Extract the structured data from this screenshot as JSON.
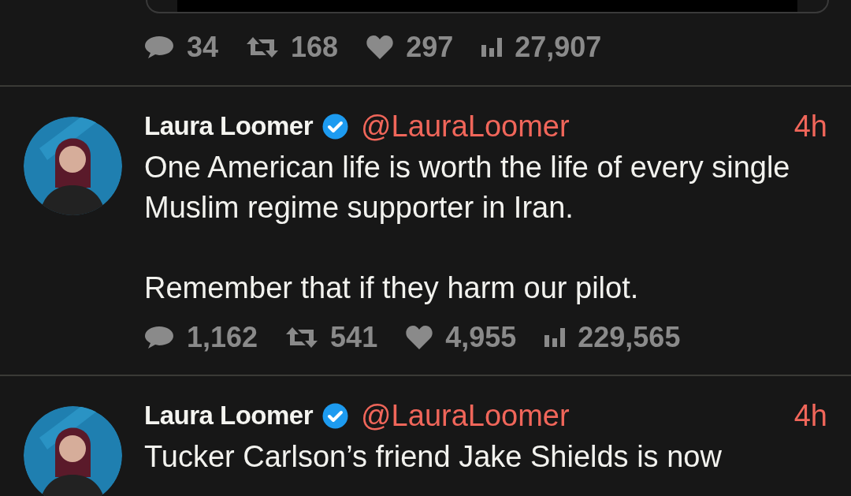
{
  "previous_post": {
    "has_media": true,
    "stats": {
      "replies": "34",
      "reposts": "168",
      "likes": "297",
      "views": "27,907"
    }
  },
  "posts": [
    {
      "author": "Laura Loomer",
      "verified": true,
      "handle": "@LauraLoomer",
      "time": "4h",
      "paragraphs": [
        "One American life is worth the life of every single Muslim regime supporter in Iran.",
        "Remember that if they harm our pilot."
      ],
      "stats": {
        "replies": "1,162",
        "reposts": "541",
        "likes": "4,955",
        "views": "229,565"
      }
    },
    {
      "author": "Laura Loomer",
      "verified": true,
      "handle": "@LauraLoomer",
      "time": "4h",
      "paragraphs": [
        "Tucker Carlson’s friend Jake Shields is now"
      ]
    }
  ]
}
